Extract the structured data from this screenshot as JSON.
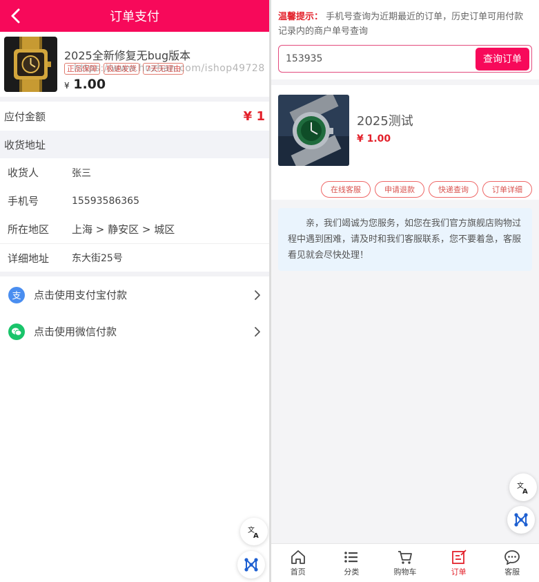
{
  "colors": {
    "brand": "#f7095a",
    "price": "#e3212b",
    "alipay": "#4a8ef0",
    "wechat": "#19c46a"
  },
  "left": {
    "header": {
      "title": "订单支付",
      "back_icon": "chevron-left-icon"
    },
    "product": {
      "name": "2025全新修复无bug版本",
      "tags": [
        "正品保障",
        "极速发货",
        "7天无理由"
      ],
      "watermark": "https://www.huzhan.com/ishop49728",
      "currency": "¥",
      "price": "1.00"
    },
    "payable": {
      "label": "应付金额",
      "amount": "¥ 1"
    },
    "address": {
      "section_title": "收货地址",
      "rows": [
        {
          "key": "收货人",
          "value": "张三"
        },
        {
          "key": "手机号",
          "value": "15593586365"
        },
        {
          "key": "所在地区",
          "value": "上海 >  静安区 >  城区"
        },
        {
          "key": "详细地址",
          "value": "东大街25号"
        }
      ]
    },
    "pay_options": [
      {
        "label": "点击使用支付宝付款",
        "icon": "alipay-icon",
        "glyph": "支"
      },
      {
        "label": "点击使用微信付款",
        "icon": "wechat-icon",
        "glyph": ""
      }
    ]
  },
  "right": {
    "tip": {
      "prefix": "温馨提示：",
      "text": "手机号查询为近期最近的订单，历史订单可用付款记录内的商户单号查询"
    },
    "search": {
      "value": "153935",
      "button": "查询订单"
    },
    "order": {
      "name": "2025测试",
      "price": "¥ 1.00",
      "buttons": [
        "在线客服",
        "申请退款",
        "快递查询",
        "订单详细"
      ]
    },
    "notice": "亲，我们竭诚为您服务，如您在我们官方旗舰店购物过程中遇到困难，请及时和我们客服联系，您不要着急，客服看见就会尽快处理！",
    "tabs": [
      {
        "label": "首页",
        "icon": "home-icon"
      },
      {
        "label": "分类",
        "icon": "list-icon"
      },
      {
        "label": "购物车",
        "icon": "cart-icon"
      },
      {
        "label": "订单",
        "icon": "order-icon",
        "active": true
      },
      {
        "label": "客服",
        "icon": "chat-icon"
      }
    ]
  }
}
